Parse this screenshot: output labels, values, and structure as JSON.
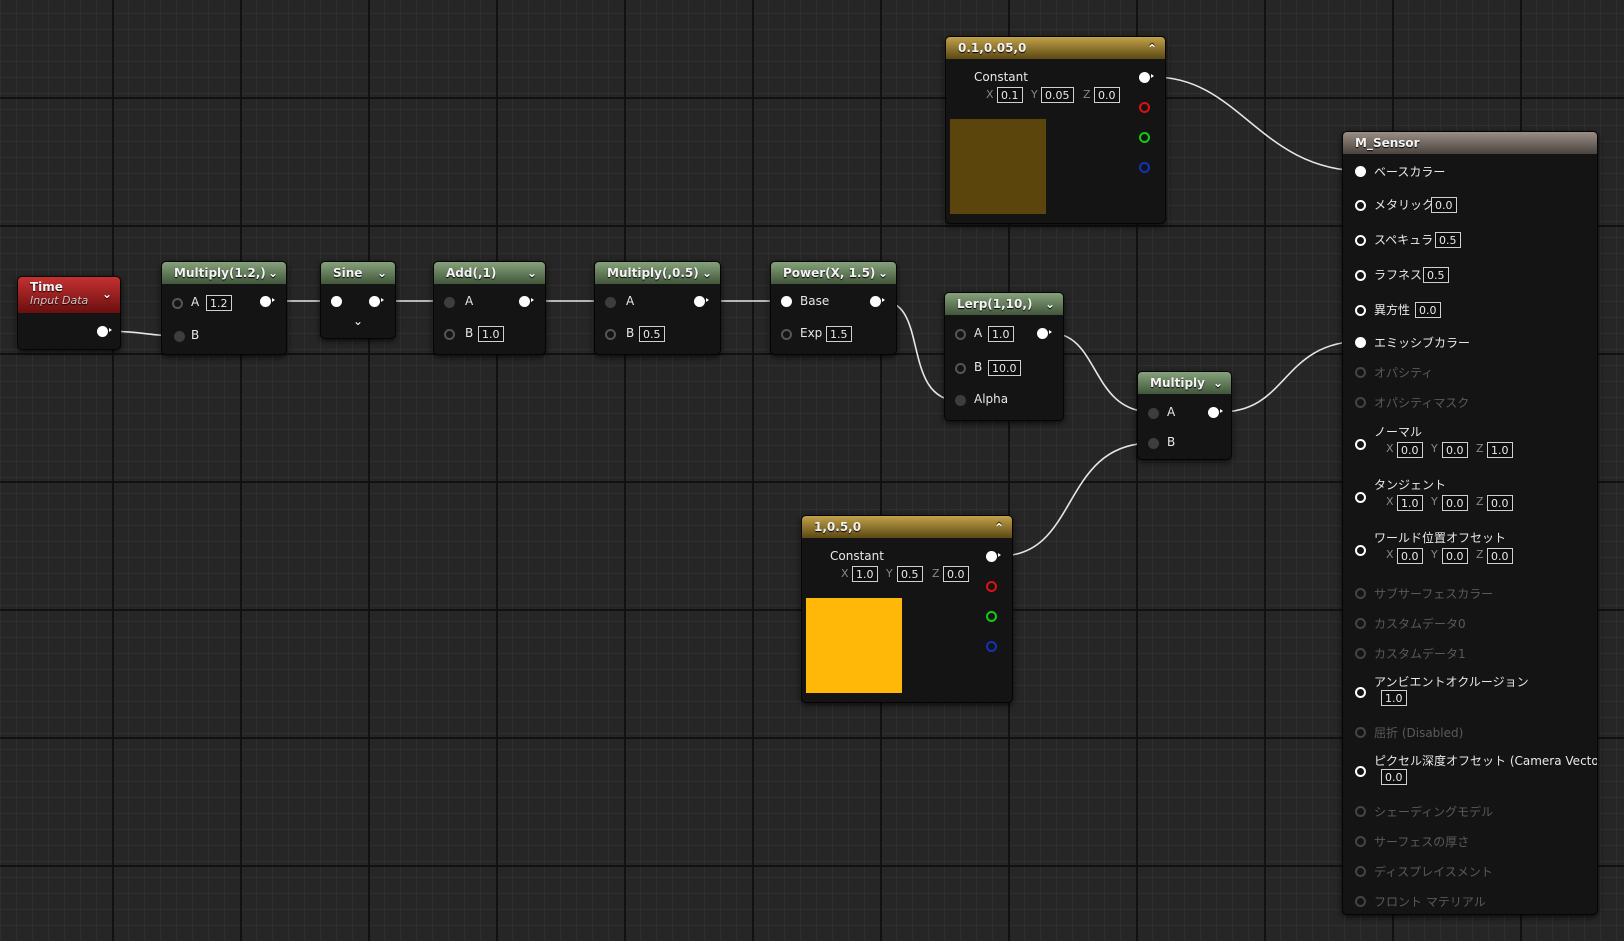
{
  "nodes": {
    "time": {
      "title": "Time",
      "subtitle": "Input Data"
    },
    "mul1": {
      "title": "Multiply(1.2,)",
      "pin_a": "A",
      "a_val": "1.2",
      "pin_b": "B"
    },
    "sine": {
      "title": "Sine"
    },
    "add": {
      "title": "Add(,1)",
      "pin_a": "A",
      "pin_b": "B",
      "b_val": "1.0"
    },
    "mul2": {
      "title": "Multiply(,0.5)",
      "pin_a": "A",
      "pin_b": "B",
      "b_val": "0.5"
    },
    "pow": {
      "title": "Power(X, 1.5)",
      "pin_base": "Base",
      "pin_exp": "Exp",
      "exp_val": "1.5"
    },
    "lerp": {
      "title": "Lerp(1,10,)",
      "pin_a": "A",
      "a_val": "1.0",
      "pin_b": "B",
      "b_val": "10.0",
      "pin_alpha": "Alpha"
    },
    "mul3": {
      "title": "Multiply",
      "pin_a": "A",
      "pin_b": "B"
    },
    "const1": {
      "title": "0.1,0.05,0",
      "label": "Constant",
      "x_label": "X",
      "x": "0.1",
      "y_label": "Y",
      "y": "0.05",
      "z_label": "Z",
      "z": "0.0",
      "swatch_color": "#5c450c"
    },
    "const2": {
      "title": "1,0.5,0",
      "label": "Constant",
      "x_label": "X",
      "x": "1.0",
      "y_label": "Y",
      "y": "0.5",
      "z_label": "Z",
      "z": "0.0",
      "swatch_color": "#ffb708"
    }
  },
  "material": {
    "title": "M_Sensor",
    "base_color": "ベースカラー",
    "metallic": "メタリック",
    "metallic_val": "0.0",
    "specular": "スペキュラ",
    "specular_val": "0.5",
    "roughness": "ラフネス",
    "roughness_val": "0.5",
    "anisotropy": "異方性",
    "anisotropy_val": "0.0",
    "emissive": "エミッシブカラー",
    "opacity": "オパシティ",
    "opacity_mask": "オパシティマスク",
    "normal": "ノーマル",
    "normal_x": "0.0",
    "normal_y": "0.0",
    "normal_z": "1.0",
    "tangent": "タンジェント",
    "tangent_x": "1.0",
    "tangent_y": "0.0",
    "tangent_z": "0.0",
    "wpo": "ワールド位置オフセット",
    "wpo_x": "0.0",
    "wpo_y": "0.0",
    "wpo_z": "0.0",
    "subsurface": "サブサーフェスカラー",
    "custom0": "カスタムデータ0",
    "custom1": "カスタムデータ1",
    "ao": "アンビエントオクルージョン",
    "ao_val": "1.0",
    "refraction": "屈折 (Disabled)",
    "pdo": "ピクセル深度オフセット (Camera Vector)",
    "pdo_val": "0.0",
    "shading_model": "シェーディングモデル",
    "surface_thickness": "サーフェスの厚さ",
    "displacement": "ディスプレイスメント",
    "front_material": "フロント マテリアル",
    "axis_x": "X",
    "axis_y": "Y",
    "axis_z": "Z"
  }
}
